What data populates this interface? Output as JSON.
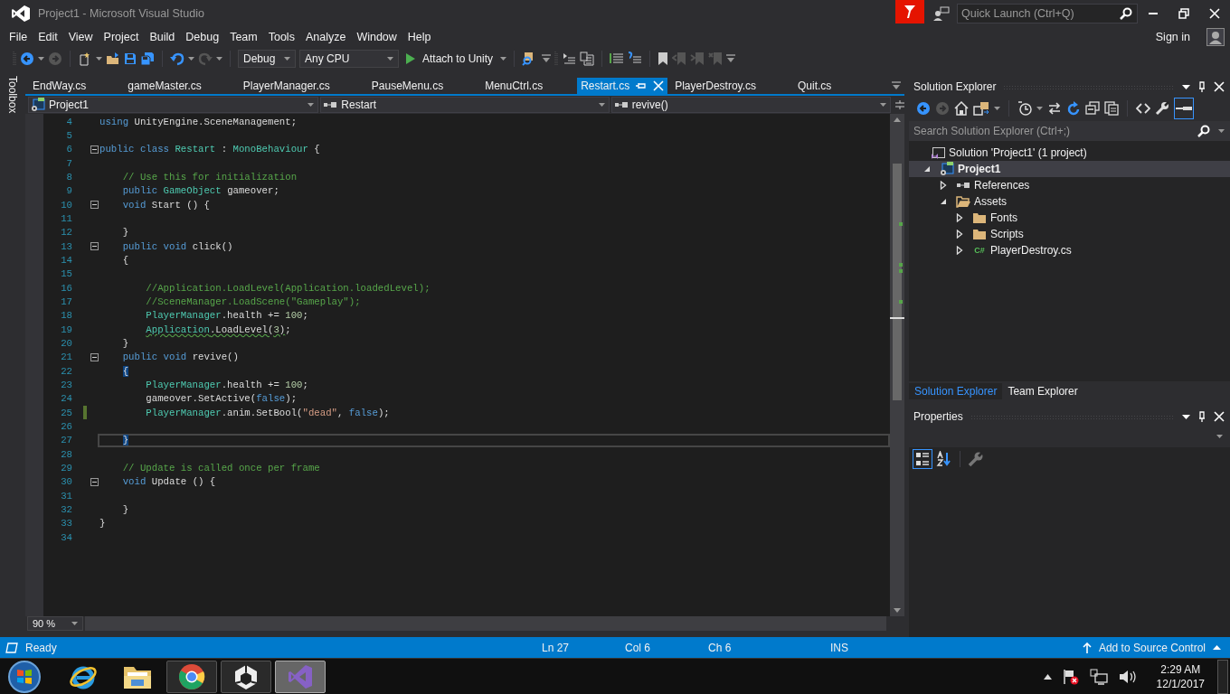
{
  "window": {
    "title": "Project1 - Microsoft Visual Studio",
    "quick_launch": {
      "placeholder": "Quick Launch (Ctrl+Q)"
    },
    "sign_in": "Sign in"
  },
  "menu": [
    "File",
    "Edit",
    "View",
    "Project",
    "Build",
    "Debug",
    "Team",
    "Tools",
    "Analyze",
    "Window",
    "Help"
  ],
  "toolbar": {
    "configuration": "Debug",
    "platform": "Any CPU",
    "start_button": "Attach to Unity"
  },
  "toolbox": {
    "label": "Toolbox"
  },
  "tabs": [
    {
      "label": "EndWay.cs",
      "selected": false
    },
    {
      "label": "gameMaster.cs",
      "selected": false
    },
    {
      "label": "PlayerManager.cs",
      "selected": false
    },
    {
      "label": "PauseMenu.cs",
      "selected": false
    },
    {
      "label": "MenuCtrl.cs",
      "selected": false
    },
    {
      "label": "Restart.cs",
      "selected": true
    },
    {
      "label": "PlayerDestroy.cs",
      "selected": false
    },
    {
      "label": "Quit.cs",
      "selected": false
    }
  ],
  "navigation": {
    "project": "Project1",
    "type": "Restart",
    "member": "revive()"
  },
  "editor": {
    "lines": [
      {
        "number": "4",
        "current": false,
        "changed": false,
        "foldable": false,
        "tokens": [
          {
            "kind": "kw",
            "text": "using"
          },
          {
            "kind": "plain",
            "text": " UnityEngine.SceneManagement;"
          }
        ]
      },
      {
        "number": "5",
        "current": false,
        "changed": false,
        "foldable": false
      },
      {
        "number": "6",
        "current": false,
        "changed": false,
        "foldable": true,
        "tokens": [
          {
            "kind": "kw",
            "text": "public class "
          },
          {
            "kind": "type",
            "text": "Restart"
          },
          {
            "kind": "plain",
            "text": " : "
          },
          {
            "kind": "type",
            "text": "MonoBehaviour"
          },
          {
            "kind": "plain",
            "text": " {"
          }
        ]
      },
      {
        "number": "7",
        "current": false,
        "changed": false,
        "foldable": false
      },
      {
        "number": "8",
        "current": false,
        "changed": false,
        "foldable": false,
        "tokens": [
          {
            "kind": "comment",
            "text": "    // Use this for initialization"
          }
        ]
      },
      {
        "number": "9",
        "current": false,
        "changed": false,
        "foldable": false,
        "tokens": [
          {
            "kind": "kw",
            "text": "    public "
          },
          {
            "kind": "type",
            "text": "GameObject"
          },
          {
            "kind": "plain",
            "text": " gameover;"
          }
        ]
      },
      {
        "number": "10",
        "current": false,
        "changed": false,
        "foldable": true,
        "tokens": [
          {
            "kind": "kw",
            "text": "    void"
          },
          {
            "kind": "plain",
            "text": " Start () {"
          }
        ]
      },
      {
        "number": "11",
        "current": false,
        "changed": false,
        "foldable": false
      },
      {
        "number": "12",
        "current": false,
        "changed": false,
        "foldable": false,
        "tokens": [
          {
            "kind": "plain",
            "text": "    }"
          }
        ]
      },
      {
        "number": "13",
        "current": false,
        "changed": false,
        "foldable": true,
        "tokens": [
          {
            "kind": "kw",
            "text": "    public void"
          },
          {
            "kind": "plain",
            "text": " click()"
          }
        ]
      },
      {
        "number": "14",
        "current": false,
        "changed": false,
        "foldable": false,
        "tokens": [
          {
            "kind": "plain",
            "text": "    {"
          }
        ]
      },
      {
        "number": "15",
        "current": false,
        "changed": false,
        "foldable": false
      },
      {
        "number": "16",
        "current": false,
        "changed": false,
        "foldable": false,
        "tokens": [
          {
            "kind": "comment",
            "text": "        //Application.LoadLevel(Application.loadedLevel);"
          }
        ]
      },
      {
        "number": "17",
        "current": false,
        "changed": false,
        "foldable": false,
        "tokens": [
          {
            "kind": "comment",
            "text": "        //SceneManager.LoadScene(\"Gameplay\");"
          }
        ]
      },
      {
        "number": "18",
        "current": false,
        "changed": false,
        "foldable": false,
        "tokens": [
          {
            "kind": "type",
            "text": "        PlayerManager"
          },
          {
            "kind": "plain",
            "text": ".health += "
          },
          {
            "kind": "number",
            "text": "100"
          },
          {
            "kind": "plain",
            "text": ";"
          }
        ]
      },
      {
        "number": "19",
        "current": false,
        "changed": false,
        "foldable": false,
        "tokens": [
          {
            "kind": "warntype",
            "text": "        Application"
          },
          {
            "kind": "warnplain",
            "text": ".LoadLevel("
          },
          {
            "kind": "warnnumber",
            "text": "3"
          },
          {
            "kind": "warnplain",
            "text": ")"
          },
          {
            "kind": "plain",
            "text": ";"
          }
        ]
      },
      {
        "number": "20",
        "current": false,
        "changed": false,
        "foldable": false,
        "tokens": [
          {
            "kind": "plain",
            "text": "    }"
          }
        ]
      },
      {
        "number": "21",
        "current": false,
        "changed": false,
        "foldable": true,
        "tokens": [
          {
            "kind": "kw",
            "text": "    public void"
          },
          {
            "kind": "plain",
            "text": " revive()"
          }
        ]
      },
      {
        "number": "22",
        "current": false,
        "changed": false,
        "foldable": false,
        "tokens": [
          {
            "kind": "match",
            "text": "    {"
          }
        ]
      },
      {
        "number": "23",
        "current": false,
        "changed": false,
        "foldable": false,
        "tokens": [
          {
            "kind": "type",
            "text": "        PlayerManager"
          },
          {
            "kind": "plain",
            "text": ".health += "
          },
          {
            "kind": "number",
            "text": "100"
          },
          {
            "kind": "plain",
            "text": ";"
          }
        ]
      },
      {
        "number": "24",
        "current": false,
        "changed": false,
        "foldable": false,
        "tokens": [
          {
            "kind": "plain",
            "text": "        gameover.SetActive("
          },
          {
            "kind": "kw",
            "text": "false"
          },
          {
            "kind": "plain",
            "text": ");"
          }
        ]
      },
      {
        "number": "25",
        "current": false,
        "changed": true,
        "foldable": false,
        "tokens": [
          {
            "kind": "type",
            "text": "        PlayerManager"
          },
          {
            "kind": "plain",
            "text": ".anim.SetBool("
          },
          {
            "kind": "string",
            "text": "\"dead\""
          },
          {
            "kind": "plain",
            "text": ", "
          },
          {
            "kind": "kw",
            "text": "false"
          },
          {
            "kind": "plain",
            "text": ");"
          }
        ]
      },
      {
        "number": "26",
        "current": false,
        "changed": false,
        "foldable": false
      },
      {
        "number": "27",
        "current": true,
        "changed": false,
        "foldable": false,
        "tokens": [
          {
            "kind": "match",
            "text": "    }"
          }
        ]
      },
      {
        "number": "28",
        "current": false,
        "changed": false,
        "foldable": false
      },
      {
        "number": "29",
        "current": false,
        "changed": false,
        "foldable": false,
        "tokens": [
          {
            "kind": "comment",
            "text": "    // Update is called once per frame"
          }
        ]
      },
      {
        "number": "30",
        "current": false,
        "changed": false,
        "foldable": true,
        "tokens": [
          {
            "kind": "kw",
            "text": "    void"
          },
          {
            "kind": "plain",
            "text": " Update () {"
          }
        ]
      },
      {
        "number": "31",
        "current": false,
        "changed": false,
        "foldable": false
      },
      {
        "number": "32",
        "current": false,
        "changed": false,
        "foldable": false,
        "tokens": [
          {
            "kind": "plain",
            "text": "    }"
          }
        ]
      },
      {
        "number": "33",
        "current": false,
        "changed": false,
        "foldable": false,
        "tokens": [
          {
            "kind": "plain",
            "text": "}"
          }
        ]
      },
      {
        "number": "34",
        "current": false,
        "changed": false,
        "foldable": false
      }
    ],
    "zoom": "90 %"
  },
  "solution_explorer": {
    "title": "Solution Explorer",
    "search": {
      "placeholder": "Search Solution Explorer (Ctrl+;)"
    },
    "solution": "Solution 'Project1' (1 project)",
    "tree": [
      {
        "label": "Project1",
        "kind": "project",
        "expanded": true,
        "selected": true,
        "children": [
          {
            "label": "References",
            "kind": "references",
            "expanded": false,
            "selected": false
          },
          {
            "label": "Assets",
            "kind": "folder",
            "expanded": true,
            "selected": false,
            "children": [
              {
                "label": "Fonts",
                "kind": "folder",
                "expanded": false,
                "selected": false
              },
              {
                "label": "Scripts",
                "kind": "folder",
                "expanded": false,
                "selected": false
              },
              {
                "label": "PlayerDestroy.cs",
                "kind": "csharp",
                "badge": "C#",
                "expanded": false,
                "selected": false
              }
            ]
          }
        ]
      }
    ]
  },
  "panel_tabs": [
    {
      "label": "Solution Explorer",
      "selected": true
    },
    {
      "label": "Team Explorer",
      "selected": false
    }
  ],
  "properties": {
    "title": "Properties"
  },
  "status_bar": {
    "message": "Ready",
    "line": "Ln 27",
    "column": "Col 6",
    "char": "Ch 6",
    "mode": "INS",
    "source_control": "Add to Source Control"
  },
  "taskbar": {
    "apps": [
      {
        "kind": "browser",
        "running": false,
        "active": false
      },
      {
        "kind": "files",
        "running": false,
        "active": false
      },
      {
        "kind": "chrome",
        "running": true,
        "active": false
      },
      {
        "kind": "unity",
        "running": true,
        "active": false
      },
      {
        "kind": "studio",
        "running": true,
        "active": true
      }
    ],
    "time": "2:29 AM",
    "date": "12/1/2017"
  }
}
